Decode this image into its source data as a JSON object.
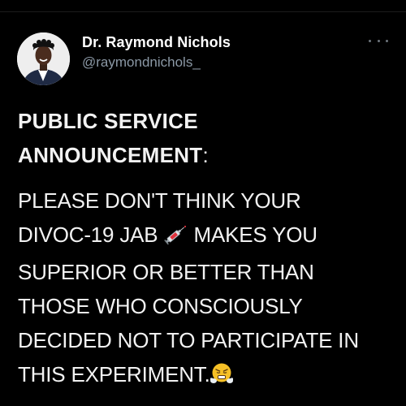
{
  "author": {
    "display_name": "Dr. Raymond Nichols",
    "handle": "@raymondnichols_"
  },
  "menu": {
    "icon": "more-horizontal-icon"
  },
  "tweet": {
    "heading_line1": "PUBLIC SERVICE",
    "heading_line2": "ANNOUNCEMENT",
    "heading_colon": ":",
    "line1": "PLEASE DON'T THINK YOUR",
    "line2_a": "DIVOC-19 JAB",
    "line2_b": "MAKES YOU",
    "line3": "SUPERIOR OR BETTER THAN",
    "line4": "THOSE WHO CONSCIOUSLY",
    "line5": "DECIDED NOT TO PARTICIPATE IN",
    "line6": "THIS EXPERIMENT.",
    "emoji_1": "syringe-icon",
    "emoji_2": "steam-nose-face-icon"
  },
  "colors": {
    "background": "#000000",
    "text": "#f2f2f2",
    "handle": "#8b98a5"
  }
}
